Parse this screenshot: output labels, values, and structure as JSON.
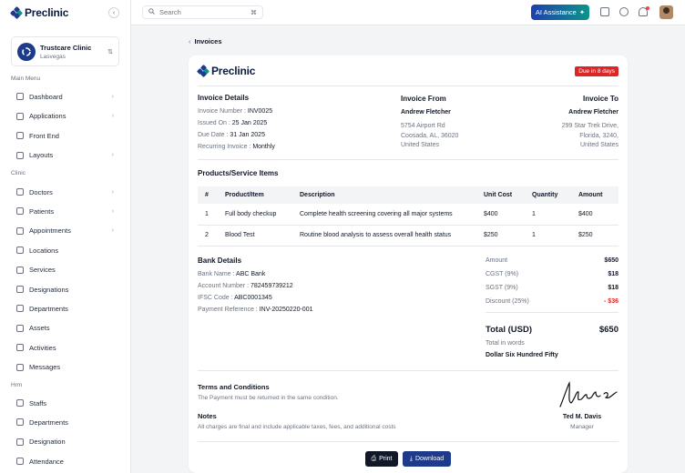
{
  "brand": {
    "name": "Preclinic"
  },
  "sidebar": {
    "clinic": {
      "name": "Trustcare Clinic",
      "location": "Lasvegas"
    },
    "main_menu_title": "Main Menu",
    "main_items": [
      {
        "label": "Dashboard",
        "chevron": true
      },
      {
        "label": "Applications",
        "chevron": true
      },
      {
        "label": "Front End",
        "chevron": false
      },
      {
        "label": "Layouts",
        "chevron": true
      }
    ],
    "clinic_title": "Clinic",
    "clinic_items": [
      {
        "label": "Doctors",
        "chevron": true
      },
      {
        "label": "Patients",
        "chevron": true
      },
      {
        "label": "Appointments",
        "chevron": true
      },
      {
        "label": "Locations",
        "chevron": false
      },
      {
        "label": "Services",
        "chevron": false
      },
      {
        "label": "Designations",
        "chevron": false
      },
      {
        "label": "Departments",
        "chevron": false
      },
      {
        "label": "Assets",
        "chevron": false
      },
      {
        "label": "Activities",
        "chevron": false
      },
      {
        "label": "Messages",
        "chevron": false
      }
    ],
    "hrm_title": "Hrm",
    "hrm_items": [
      {
        "label": "Staffs",
        "chevron": false
      },
      {
        "label": "Departments",
        "chevron": false
      },
      {
        "label": "Designation",
        "chevron": false
      },
      {
        "label": "Attendance",
        "chevron": false
      }
    ]
  },
  "header": {
    "search_placeholder": "Search",
    "search_shortcut": "⌘",
    "ai_button": "AI Assistance"
  },
  "breadcrumb": {
    "back_label": "Invoices"
  },
  "invoice": {
    "due_badge": "Due in 8 days",
    "details_title": "Invoice Details",
    "number_label": "Invoice Number :",
    "number": "INV0025",
    "issued_label": "Issued On :",
    "issued": "25 Jan 2025",
    "due_label": "Due Date :",
    "due": "31 Jan 2025",
    "recurring_label": "Recurring Invoice :",
    "recurring": "Monthly",
    "from_title": "Invoice From",
    "from_name": "Andrew Fletcher",
    "from_line1": "5754 Airport Rd",
    "from_line2": "Coosada, AL, 36020",
    "from_line3": "United States",
    "to_title": "Invoice To",
    "to_name": "Andrew Fletcher",
    "to_line1": "299 Star Trek Drive,",
    "to_line2": "Florida, 3240,",
    "to_line3": "United States",
    "items_title": "Products/Service Items",
    "columns": [
      "#",
      "Product/Item",
      "Description",
      "Unit Cost",
      "Quantity",
      "Amount"
    ],
    "rows": [
      [
        "1",
        "Full body checkup",
        "Complete health screening covering all major systems",
        "$400",
        "1",
        "$400"
      ],
      [
        "2",
        "Blood Test",
        "Routine blood analysis to assess overall health status",
        "$250",
        "1",
        "$250"
      ]
    ],
    "bank_title": "Bank Details",
    "bank_name_label": "Bank Name :",
    "bank_name": "ABC Bank",
    "account_label": "Account Number :",
    "account": "782459739212",
    "ifsc_label": "IFSC Code :",
    "ifsc": "ABC0001345",
    "ref_label": "Payment Reference :",
    "ref": "INV-20250220-001",
    "summary": [
      {
        "label": "Amount",
        "value": "$650",
        "negative": false
      },
      {
        "label": "CGST (9%)",
        "value": "$18",
        "negative": false
      },
      {
        "label": "SGST (9%)",
        "value": "$18",
        "negative": false
      },
      {
        "label": "Discount (25%)",
        "value": "- $36",
        "negative": true
      }
    ],
    "total_label": "Total (USD)",
    "total": "$650",
    "words_label": "Total in words",
    "words": "Dollar Six Hundred Fifty",
    "terms_title": "Terms and Conditions",
    "terms_text": "The Payment must be returned in the same condition.",
    "notes_title": "Notes",
    "notes_text": "All charges are final and include applicable taxes, fees, and additional costs",
    "signer_name": "Ted M. Davis",
    "signer_role": "Manager",
    "print_label": "Print",
    "download_label": "Download"
  }
}
